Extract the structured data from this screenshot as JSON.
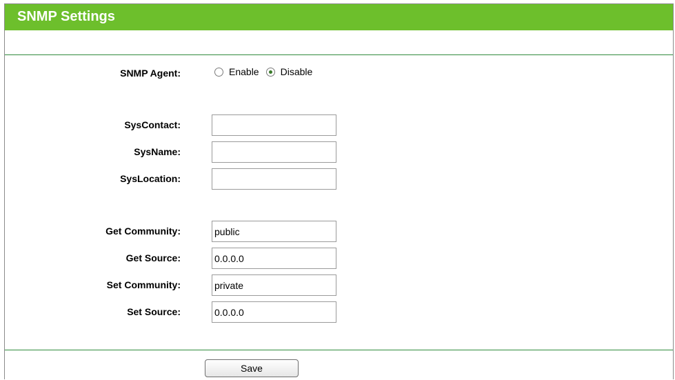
{
  "header": {
    "title": "SNMP Settings"
  },
  "agent": {
    "label": "SNMP Agent:",
    "options": [
      "Enable",
      "Disable"
    ],
    "selected": "Disable"
  },
  "fields": {
    "syscontact": {
      "label": "SysContact:",
      "value": ""
    },
    "sysname": {
      "label": "SysName:",
      "value": ""
    },
    "syslocation": {
      "label": "SysLocation:",
      "value": ""
    },
    "get_community": {
      "label": "Get Community:",
      "value": "public"
    },
    "get_source": {
      "label": "Get Source:",
      "value": "0.0.0.0"
    },
    "set_community": {
      "label": "Set Community:",
      "value": "private"
    },
    "set_source": {
      "label": "Set Source:",
      "value": "0.0.0.0"
    }
  },
  "actions": {
    "save_label": "Save"
  },
  "colors": {
    "header_bg": "#6dbf2c",
    "divider": "#2f8a3c"
  }
}
